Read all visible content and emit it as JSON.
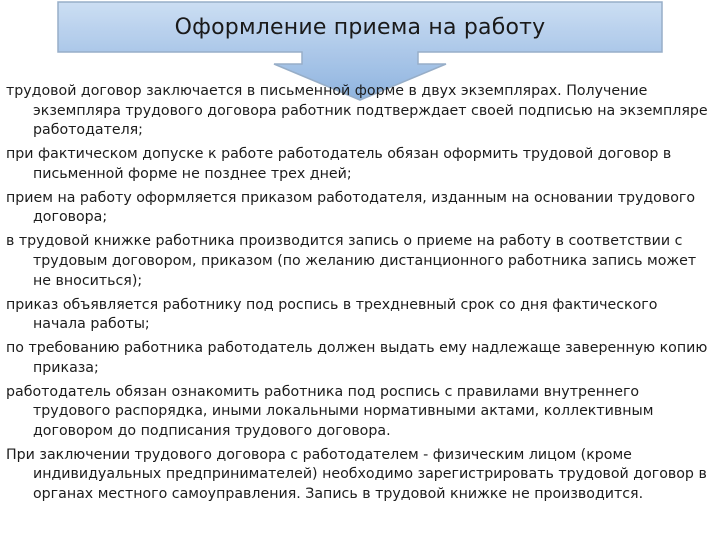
{
  "slide": {
    "title": "Оформление приема на работу",
    "colors": {
      "banner_top": "#b4d0ee",
      "banner_bottom": "#88b0de",
      "banner_border": "#8fa8c4",
      "text": "#1c1c1c"
    },
    "paragraphs": [
      "трудовой договор заключается в письменной форме в двух экземплярах. Получение экземпляра трудового договора работник подтверждает своей подписью на экземпляре работодателя;",
      "при фактическом допуске к работе работодатель обязан оформить трудовой договор в письменной форме не позднее трех дней;",
      "прием на работу оформляется приказом работодателя, изданным на основании трудового договора;",
      "в трудовой книжке работника производится запись о приеме на работу в соответствии с трудовым договором, приказом (по желанию дистанционного работника запись может не вноситься);",
      "приказ объявляется работнику под роспись в трехдневный срок со дня фактического начала работы;",
      "по требованию работника работодатель должен выдать ему надлежаще заверенную копию приказа;",
      "работодатель обязан ознакомить работника под роспись с правилами внутреннего трудового распорядка, иными локальными нормативными актами, коллективным договором до подписания трудового договора.",
      "При заключении трудового договора с работодателем - физическим лицом (кроме индивидуальных предпринимателей) необходимо зарегистрировать трудовой договор в органах местного самоуправления. Запись в трудовой книжке не производится."
    ]
  }
}
